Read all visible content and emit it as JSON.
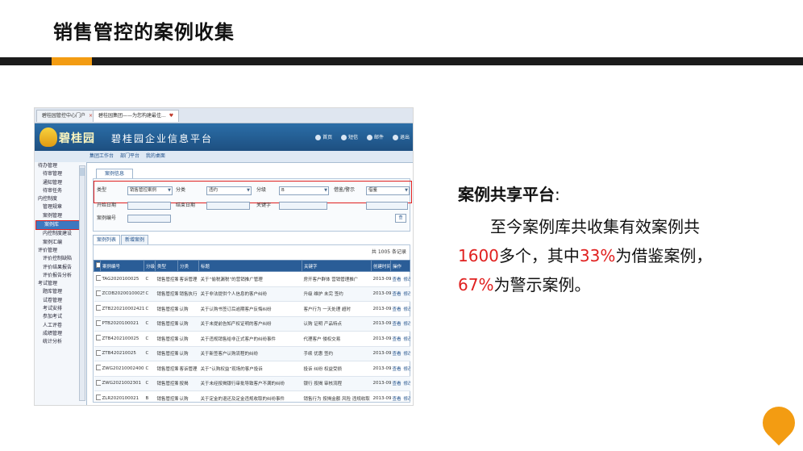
{
  "slide": {
    "title": "销售管控的案例收集"
  },
  "browser": {
    "tabs": [
      {
        "label": "碧桂园管控中心门户",
        "active": false
      },
      {
        "label": "碧桂园集团——为您构建最佳...",
        "active": true
      }
    ]
  },
  "app": {
    "logo": "碧桂园",
    "title": "碧桂园企业信息平台",
    "header_links": [
      "首页",
      "短信",
      "邮件",
      "退出"
    ],
    "subnav": [
      "集团工作台",
      "部门平台",
      "我的桌面"
    ],
    "sidebar": [
      {
        "label": "待办管理",
        "level": 0
      },
      {
        "label": "待审管理",
        "level": 1
      },
      {
        "label": "通知管理",
        "level": 1
      },
      {
        "label": "待审任务",
        "level": 1
      },
      {
        "label": "内控制度",
        "level": 0
      },
      {
        "label": "管理规章",
        "level": 1
      },
      {
        "label": "案例管理",
        "level": 1
      },
      {
        "label": "案例库",
        "level": 1,
        "selected": true
      },
      {
        "label": "内控制度建设",
        "level": 1
      },
      {
        "label": "案例汇编",
        "level": 1
      },
      {
        "label": "评价管理",
        "level": 0
      },
      {
        "label": "评价控制缺陷",
        "level": 1
      },
      {
        "label": "评价结果报告",
        "level": 1
      },
      {
        "label": "评价报告分析",
        "level": 1
      },
      {
        "label": "考试管理",
        "level": 0
      },
      {
        "label": "题库管理",
        "level": 1
      },
      {
        "label": "试卷管理",
        "level": 1
      },
      {
        "label": "考试安排",
        "level": 1
      },
      {
        "label": "参加考试",
        "level": 1
      },
      {
        "label": "人工评卷",
        "level": 1
      },
      {
        "label": "成绩管理",
        "level": 1
      },
      {
        "label": "统计分析",
        "level": 1
      }
    ],
    "form_tab": "案例信息",
    "filters": {
      "type_label": "类型",
      "type_value": "销售管控案例",
      "category_label": "分类",
      "category_value": "违约",
      "grade_label": "分级",
      "grade_value": "B",
      "nature_label": "借鉴/警示",
      "nature_value": "借鉴",
      "date_label": "开始日期",
      "end_date_label": "结束日期",
      "keyword_label": "关键字",
      "case_no_label": "案例编号",
      "search_button": "查"
    },
    "list_tabs": [
      "案例列表",
      "新增案例"
    ],
    "record_count": "共 1005 条记录",
    "columns": [
      "案例编号",
      "分级",
      "类型",
      "分类",
      "标题",
      "关键字",
      "创建时间",
      "操作"
    ],
    "rows": [
      {
        "no": "TAG2020100025",
        "grade": "C",
        "type": "销售管控案例",
        "cat": "客诉管理",
        "title": "关于“偷税漏税”的营销推广管理",
        "kw": "房开客户群体 营销管理推广",
        "date": "2013-09-30",
        "ops": [
          "查看",
          "修改"
        ]
      },
      {
        "no": "ZCDB20200100025",
        "grade": "C",
        "type": "销售管控案例",
        "cat": "销售执行",
        "title": "关于非法提供个人信息的客户纠纷",
        "kw": "升级 维护 未完 签约",
        "date": "2013-09-30",
        "ops": [
          "查看",
          "修改"
        ]
      },
      {
        "no": "ZTB220210002421",
        "grade": "C",
        "type": "销售管控案例",
        "cat": "认购",
        "title": "关于认购书签订后逾期客户反悔纠纷",
        "kw": "客户行为 一天处理 超时",
        "date": "2013-09-30",
        "ops": [
          "查看",
          "修改"
        ]
      },
      {
        "no": "PTB2020100021",
        "grade": "C",
        "type": "销售管控案例",
        "cat": "认购",
        "title": "关于未提前告知产权证明的客户纠纷",
        "kw": "认购 证明 产品特点",
        "date": "2013-09-30",
        "ops": [
          "查看",
          "修改"
        ]
      },
      {
        "no": "ZTB4202100025",
        "grade": "C",
        "type": "销售管控案例",
        "cat": "认购",
        "title": "关于违规销售给非正式客户的纠纷事件",
        "kw": "代理客户 侵权交易",
        "date": "2013-09-30",
        "ops": [
          "查看",
          "修改"
        ]
      },
      {
        "no": "ZTB420210025",
        "grade": "C",
        "type": "销售管控案例",
        "cat": "认购",
        "title": "关于新签客户认购流程的纠纷",
        "kw": "手续 优惠 签约",
        "date": "2013-09-30",
        "ops": [
          "查看",
          "修改"
        ]
      },
      {
        "no": "ZWG202100024001",
        "grade": "C",
        "type": "销售管控案例",
        "cat": "客诉管理",
        "title": "关于“认购权益”现场的客户投诉",
        "kw": "投诉 纠纷 权益受损",
        "date": "2013-09-30",
        "ops": [
          "查看",
          "修改"
        ]
      },
      {
        "no": "ZWG2021002301",
        "grade": "C",
        "type": "销售管控案例",
        "cat": "按揭",
        "title": "关于未经按揭银行审批导致客户不满的纠纷",
        "kw": "银行 按揭 审核流程",
        "date": "2013-09-30",
        "ops": [
          "查看",
          "修改"
        ]
      },
      {
        "no": "ZLR2020100021",
        "grade": "B",
        "type": "销售管控案例",
        "cat": "认购",
        "title": "关于定金的退还及定金违规收取的纠纷事件",
        "kw": "销售行为 按揭金额 风险 违规收取",
        "date": "2013-09-30",
        "ops": [
          "查看",
          "修改"
        ]
      }
    ]
  },
  "info": {
    "heading": "案例共享平台",
    "line1": "至今案例库共收集有效案例共",
    "count": "1600",
    "line2a": "多个，其中",
    "pct1": "33%",
    "line2b": "为借鉴案例，",
    "pct2": "67%",
    "line3": "为警示案例。"
  },
  "colors": {
    "accent": "#f39c12",
    "bar": "#1b1b1b",
    "highlight": "#e0201f"
  }
}
